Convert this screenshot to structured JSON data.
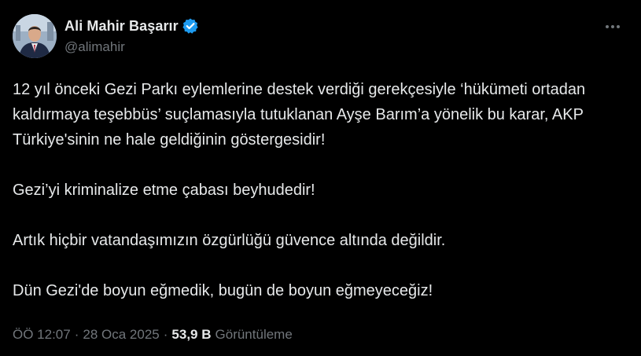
{
  "author": {
    "display_name": "Ali Mahir Başarır",
    "handle": "@alimahir",
    "verified": true,
    "verified_color": "#1d9bf0"
  },
  "tweet": {
    "paragraphs": [
      "12 yıl önceki Gezi Parkı eylemlerine destek verdiği gerekçesiyle ‘hükümeti ortadan kaldırmaya teşebbüs’ suçlamasıyla tutuklanan Ayşe Barım’a yönelik bu karar, AKP Türkiye'sinin ne hale geldiğinin göstergesidir!",
      "Gezi’yi kriminalize etme çabası beyhudedir!",
      "Artık hiçbir vatandaşımızın özgürlüğü güvence altında değildir.",
      "Dün Gezi'de boyun eğmedik, bugün de boyun eğmeyeceğiz!"
    ]
  },
  "meta": {
    "time": "ÖÖ 12:07",
    "separator": "·",
    "date": "28 Oca 2025",
    "views_count": "53,9 B",
    "views_label": "Görüntüleme"
  },
  "icons": {
    "more": "more-horizontal-icon",
    "verified": "verified-badge-icon"
  },
  "colors": {
    "background": "#000000",
    "text": "#e7e9ea",
    "secondary": "#71767b"
  }
}
